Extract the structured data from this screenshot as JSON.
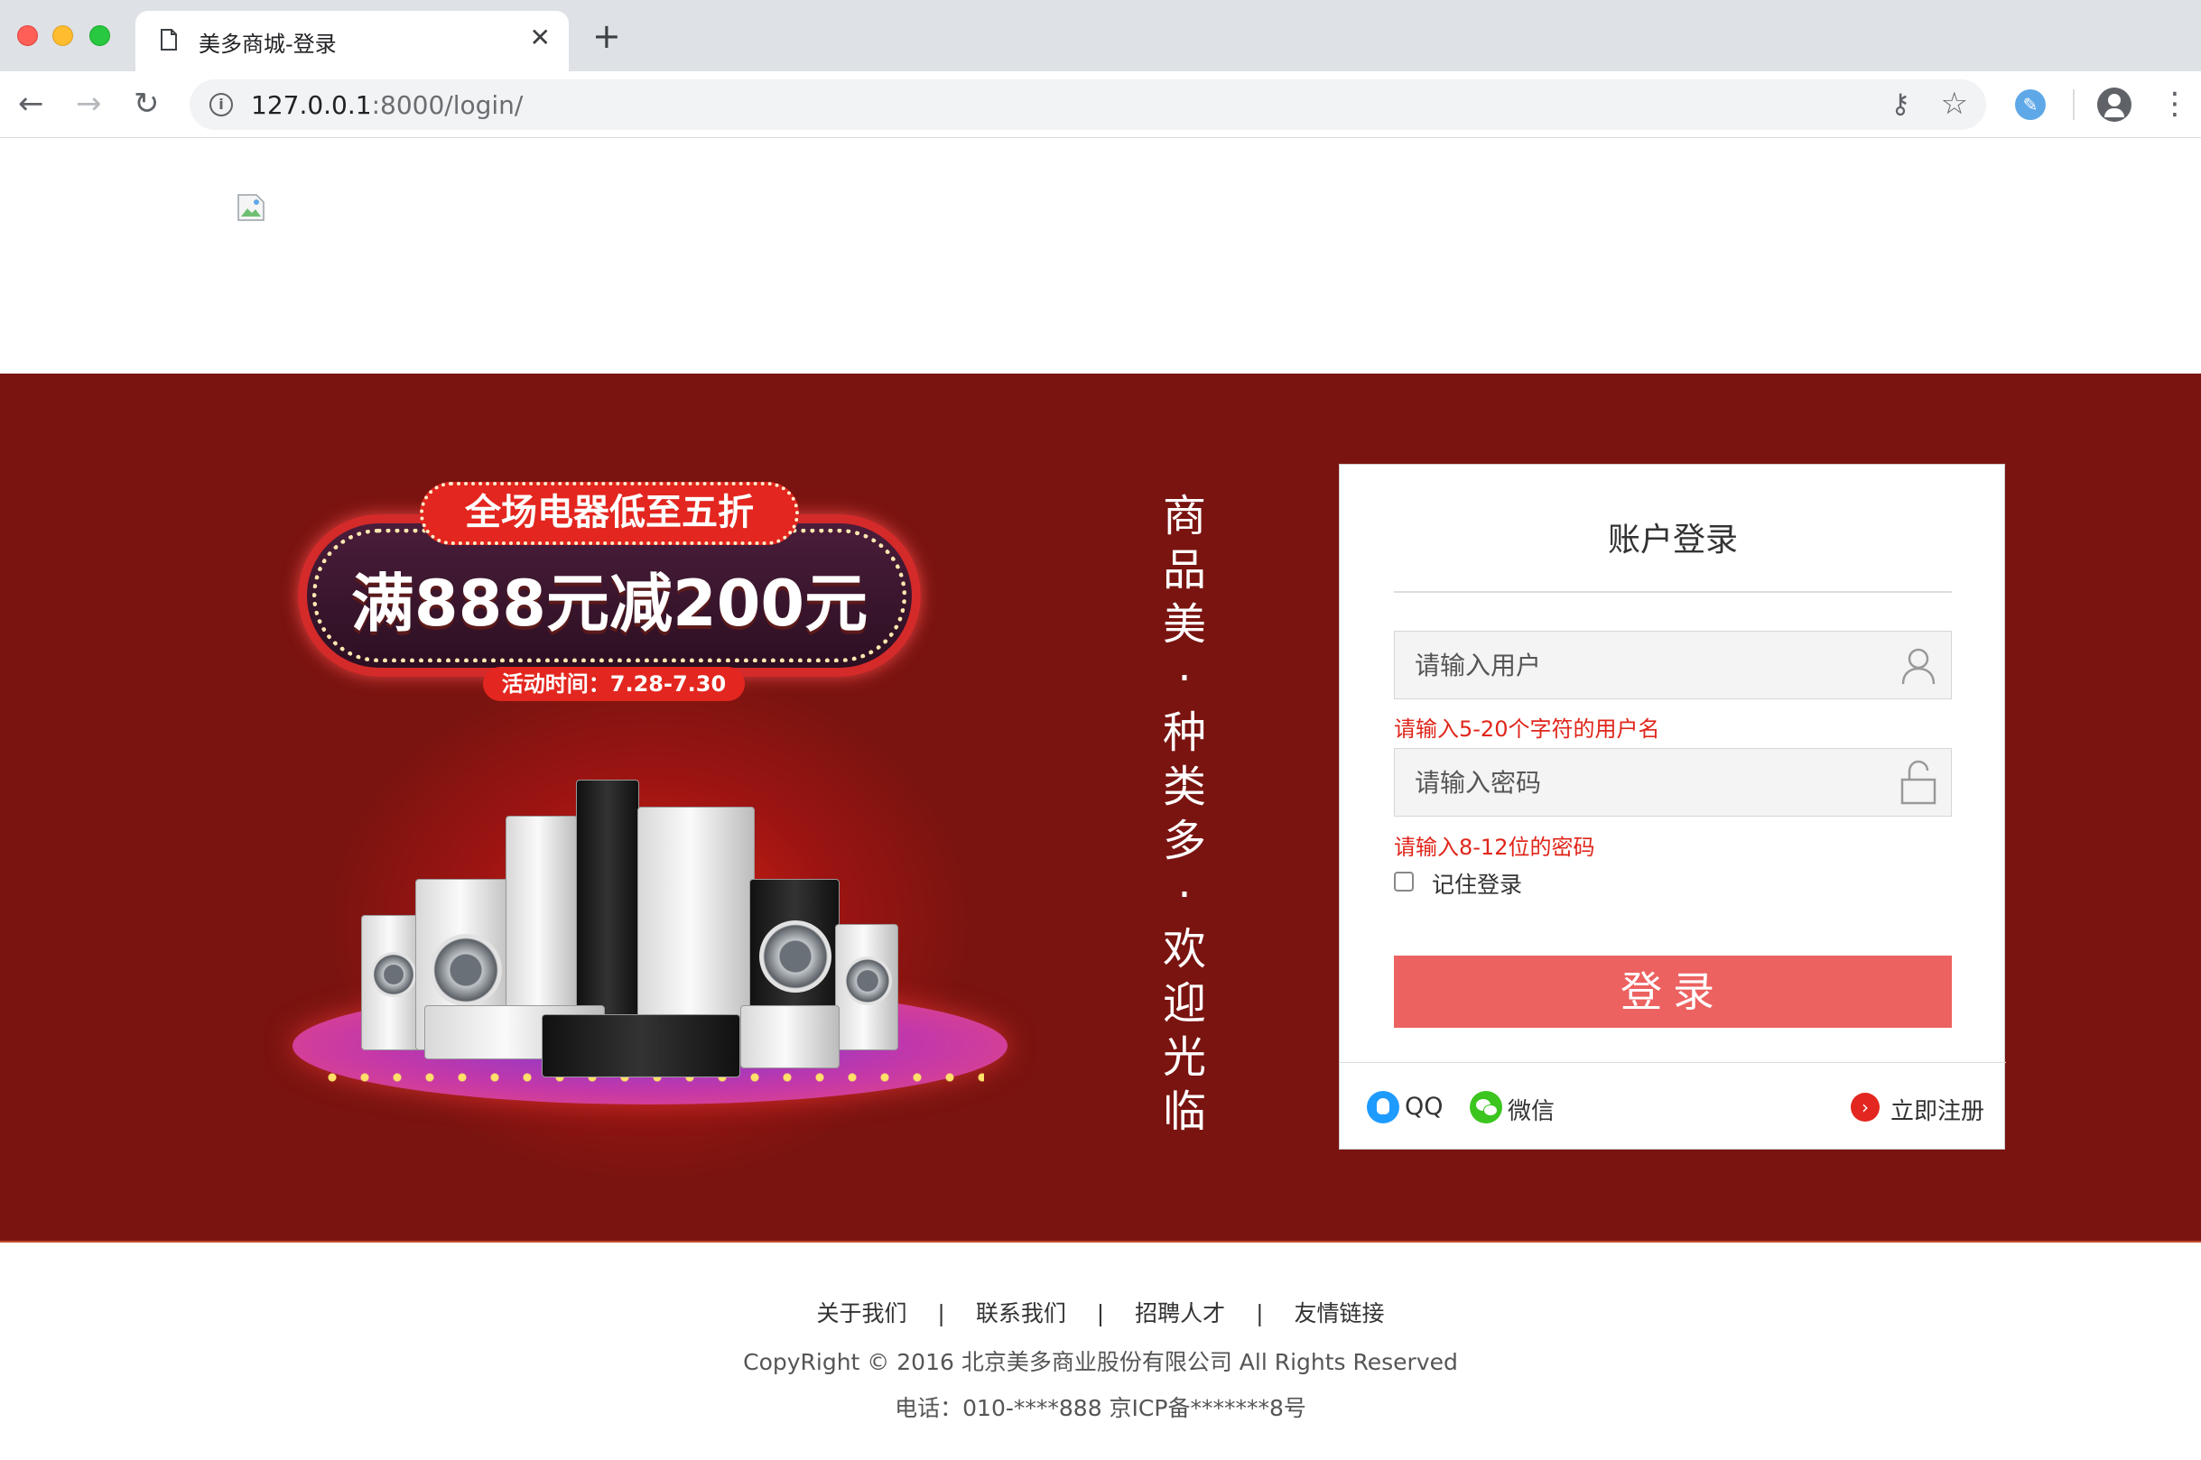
{
  "browser": {
    "tab_title": "美多商城-登录",
    "tab_close": "✕",
    "new_tab": "+",
    "url_host": "127.0.0.1",
    "url_rest": ":8000/login/"
  },
  "banner": {
    "promo_top": "全场电器低至五折",
    "promo_main": "满888元减200元",
    "promo_date": "活动时间：7.28-7.30",
    "slogan": "商\n品\n美\n·\n种\n类\n多\n·\n欢\n迎\n光\n临"
  },
  "login": {
    "title": "账户登录",
    "username_placeholder": "请输入用户",
    "username_error": "请输入5-20个字符的用户名",
    "password_placeholder": "请输入密码",
    "password_error": "请输入8-12位的密码",
    "remember_label": "记住登录",
    "submit_label": "登录",
    "qq_label": "QQ",
    "wechat_label": "微信",
    "register_label": "立即注册"
  },
  "footer": {
    "links": [
      "关于我们",
      "联系我们",
      "招聘人才",
      "友情链接"
    ],
    "separator": "|",
    "copyright": "CopyRight © 2016 北京美多商业股份有限公司 All Rights Reserved",
    "phone": "电话：010-****888 京ICP备*******8号"
  }
}
